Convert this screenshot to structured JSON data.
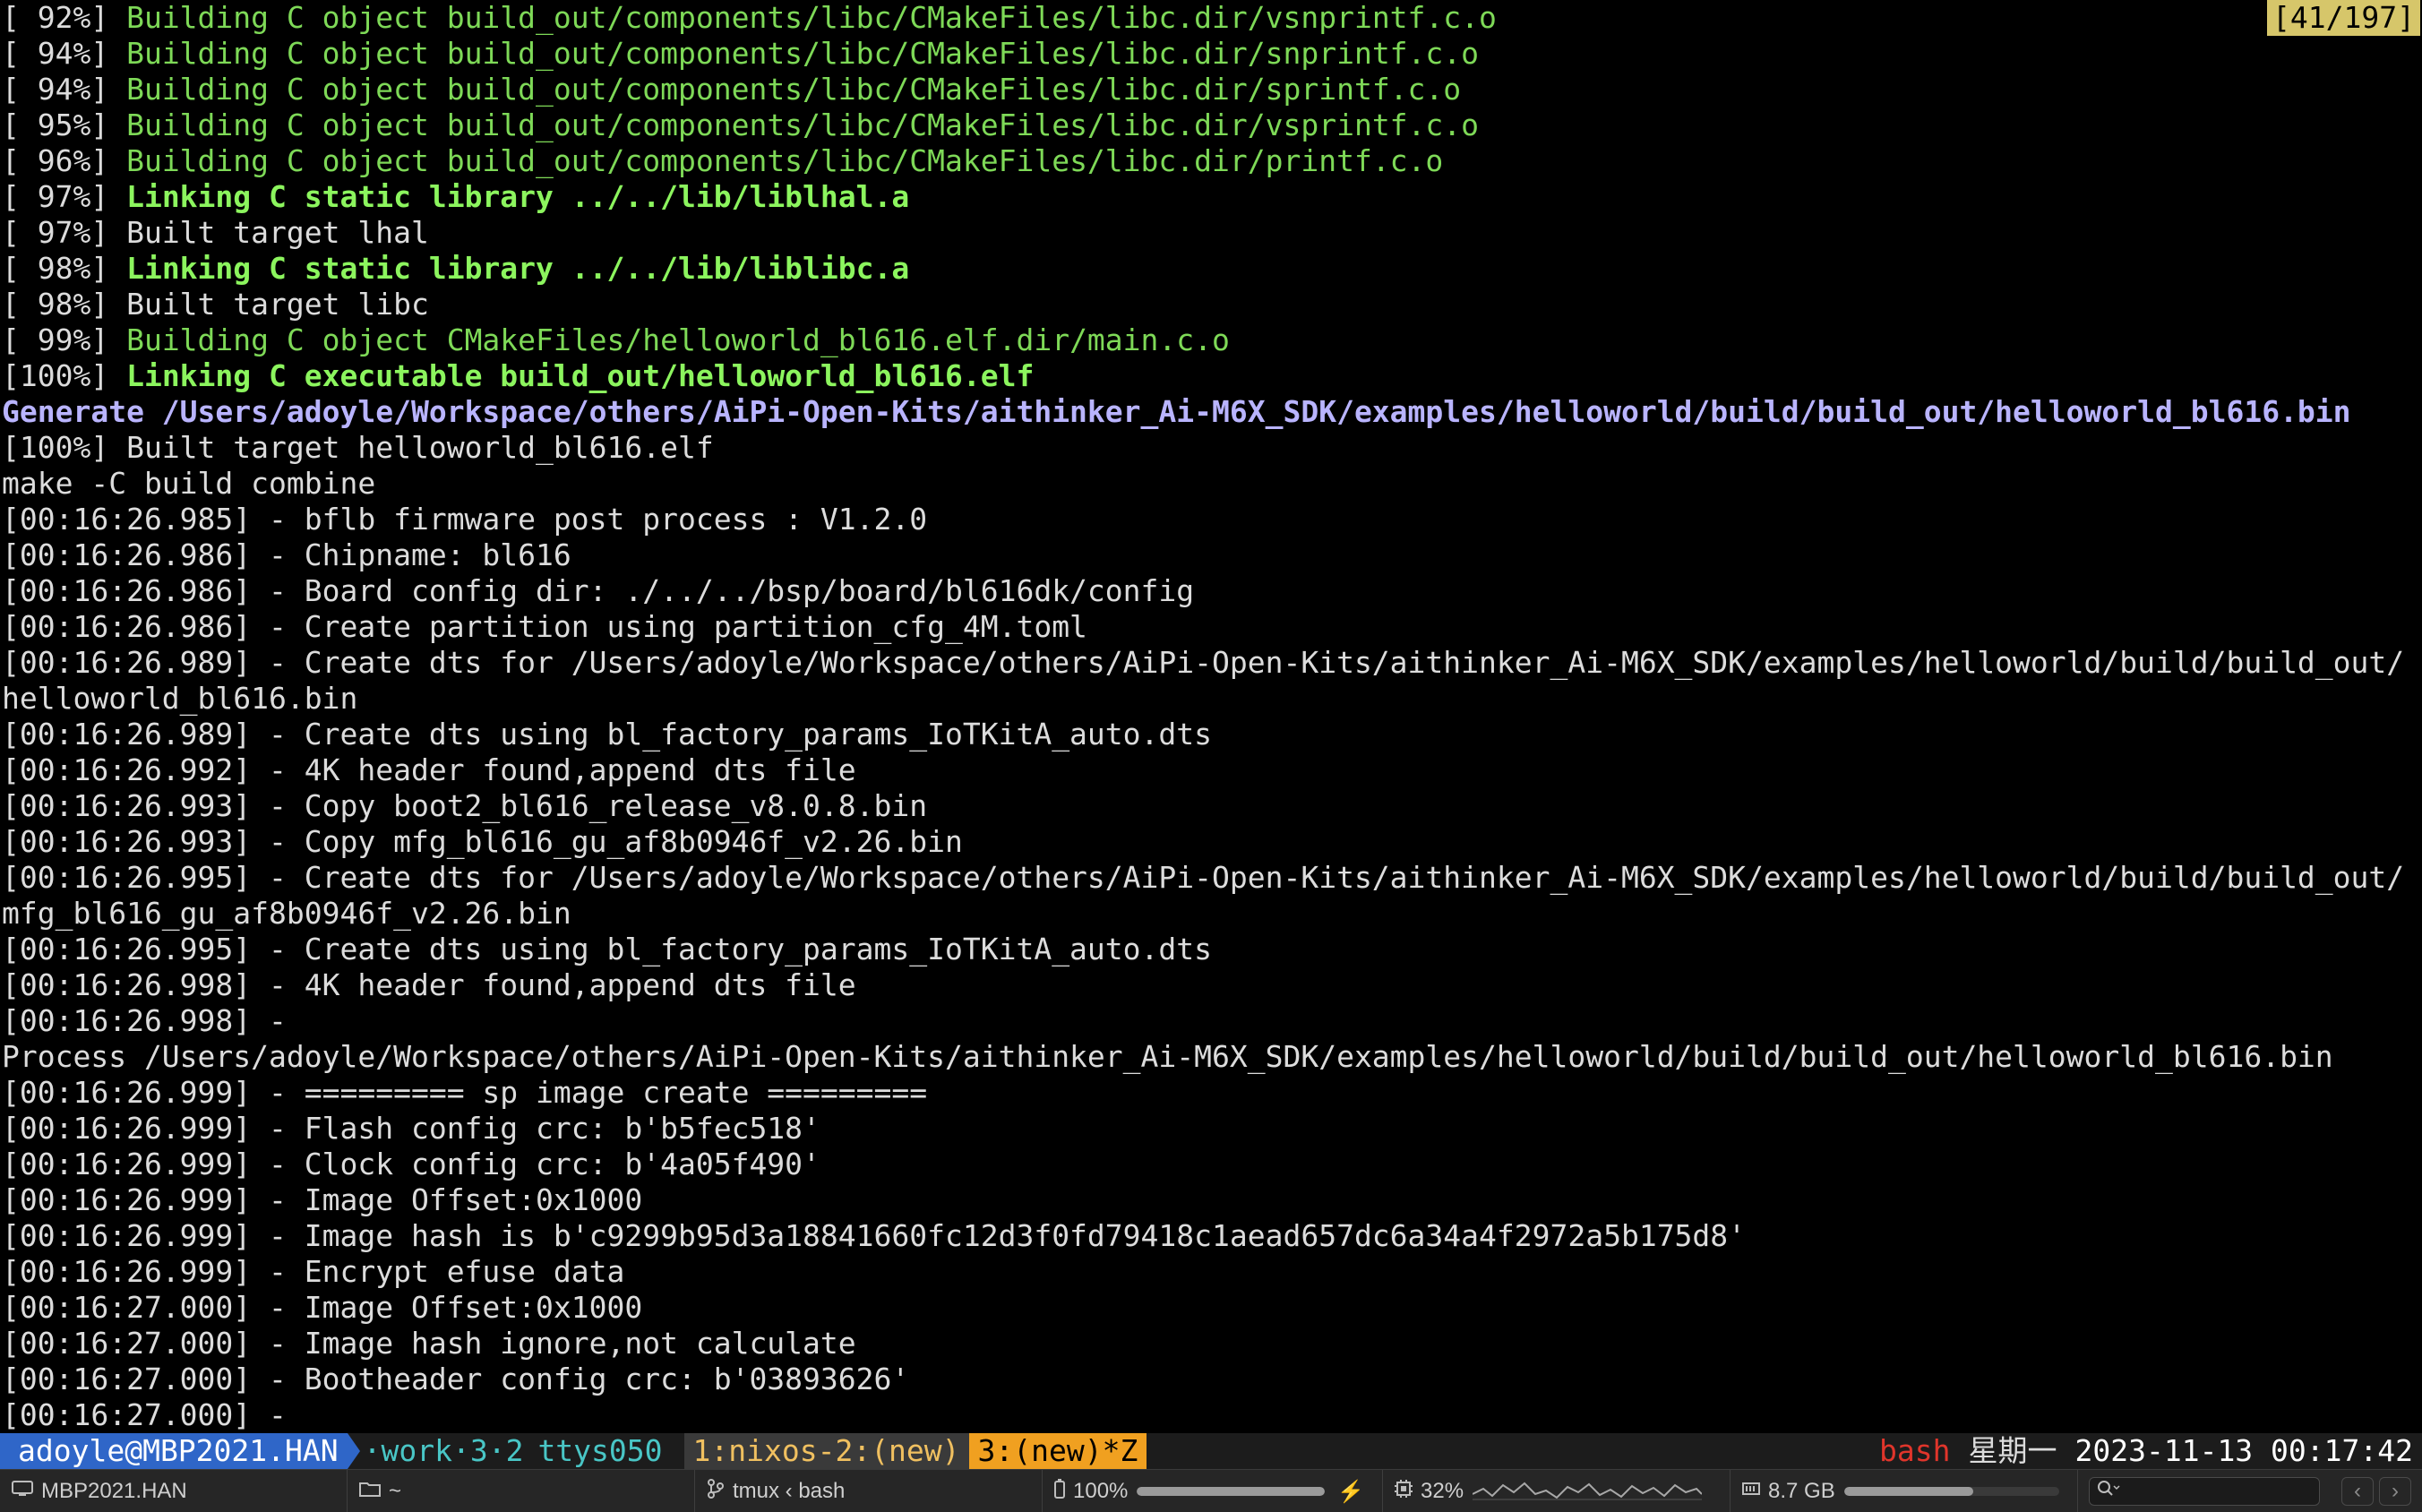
{
  "terminal": {
    "page_counter": "[41/197]",
    "lines": [
      {
        "prefix": "[ 92%] ",
        "text": "Building C object build_out/components/libc/CMakeFiles/libc.dir/vsnprintf.c.o",
        "style": "c-green"
      },
      {
        "prefix": "[ 94%] ",
        "text": "Building C object build_out/components/libc/CMakeFiles/libc.dir/snprintf.c.o",
        "style": "c-green"
      },
      {
        "prefix": "[ 94%] ",
        "text": "Building C object build_out/components/libc/CMakeFiles/libc.dir/sprintf.c.o",
        "style": "c-green"
      },
      {
        "prefix": "[ 95%] ",
        "text": "Building C object build_out/components/libc/CMakeFiles/libc.dir/vsprintf.c.o",
        "style": "c-green"
      },
      {
        "prefix": "[ 96%] ",
        "text": "Building C object build_out/components/libc/CMakeFiles/libc.dir/printf.c.o",
        "style": "c-green"
      },
      {
        "prefix": "[ 97%] ",
        "text": "Linking C static library ../../lib/liblhal.a",
        "style": "c-bgreen"
      },
      {
        "prefix": "[ 97%] ",
        "text": "Built target lhal",
        "style": "c-default"
      },
      {
        "prefix": "[ 98%] ",
        "text": "Linking C static library ../../lib/liblibc.a",
        "style": "c-bgreen"
      },
      {
        "prefix": "[ 98%] ",
        "text": "Built target libc",
        "style": "c-default"
      },
      {
        "prefix": "[ 99%] ",
        "text": "Building C object CMakeFiles/helloworld_bl616.elf.dir/main.c.o",
        "style": "c-green"
      },
      {
        "prefix": "[100%] ",
        "text": "Linking C executable build_out/helloworld_bl616.elf",
        "style": "c-bgreen"
      },
      {
        "prefix": "",
        "text": "Generate /Users/adoyle/Workspace/others/AiPi-Open-Kits/aithinker_Ai-M6X_SDK/examples/helloworld/build/build_out/helloworld_bl616.bin",
        "style": "c-purple"
      },
      {
        "prefix": "[100%] ",
        "text": "Built target helloworld_bl616.elf",
        "style": "c-default"
      },
      {
        "prefix": "",
        "text": "make -C build combine",
        "style": "c-default"
      },
      {
        "prefix": "",
        "text": "[00:16:26.985] - bflb firmware post process : V1.2.0",
        "style": "c-default"
      },
      {
        "prefix": "",
        "text": "[00:16:26.986] - Chipname: bl616",
        "style": "c-default"
      },
      {
        "prefix": "",
        "text": "[00:16:26.986] - Board config dir: ./../../bsp/board/bl616dk/config",
        "style": "c-default"
      },
      {
        "prefix": "",
        "text": "[00:16:26.986] - Create partition using partition_cfg_4M.toml",
        "style": "c-default"
      },
      {
        "prefix": "",
        "text": "[00:16:26.989] - Create dts for /Users/adoyle/Workspace/others/AiPi-Open-Kits/aithinker_Ai-M6X_SDK/examples/helloworld/build/build_out/",
        "style": "c-default"
      },
      {
        "prefix": "",
        "text": "helloworld_bl616.bin",
        "style": "c-default"
      },
      {
        "prefix": "",
        "text": "[00:16:26.989] - Create dts using bl_factory_params_IoTKitA_auto.dts",
        "style": "c-default"
      },
      {
        "prefix": "",
        "text": "[00:16:26.992] - 4K header found,append dts file",
        "style": "c-default"
      },
      {
        "prefix": "",
        "text": "[00:16:26.993] - Copy boot2_bl616_release_v8.0.8.bin",
        "style": "c-default"
      },
      {
        "prefix": "",
        "text": "[00:16:26.993] - Copy mfg_bl616_gu_af8b0946f_v2.26.bin",
        "style": "c-default"
      },
      {
        "prefix": "",
        "text": "[00:16:26.995] - Create dts for /Users/adoyle/Workspace/others/AiPi-Open-Kits/aithinker_Ai-M6X_SDK/examples/helloworld/build/build_out/",
        "style": "c-default"
      },
      {
        "prefix": "",
        "text": "mfg_bl616_gu_af8b0946f_v2.26.bin",
        "style": "c-default"
      },
      {
        "prefix": "",
        "text": "[00:16:26.995] - Create dts using bl_factory_params_IoTKitA_auto.dts",
        "style": "c-default"
      },
      {
        "prefix": "",
        "text": "[00:16:26.998] - 4K header found,append dts file",
        "style": "c-default"
      },
      {
        "prefix": "",
        "text": "[00:16:26.998] -",
        "style": "c-default"
      },
      {
        "prefix": "",
        "text": "Process /Users/adoyle/Workspace/others/AiPi-Open-Kits/aithinker_Ai-M6X_SDK/examples/helloworld/build/build_out/helloworld_bl616.bin",
        "style": "c-default"
      },
      {
        "prefix": "",
        "text": "[00:16:26.999] - ========= sp image create =========",
        "style": "c-default"
      },
      {
        "prefix": "",
        "text": "[00:16:26.999] - Flash config crc: b'b5fec518'",
        "style": "c-default"
      },
      {
        "prefix": "",
        "text": "[00:16:26.999] - Clock config crc: b'4a05f490'",
        "style": "c-default"
      },
      {
        "prefix": "",
        "text": "[00:16:26.999] - Image Offset:0x1000",
        "style": "c-default"
      },
      {
        "prefix": "",
        "text": "[00:16:26.999] - Image hash is b'c9299b95d3a18841660fc12d3f0fd79418c1aead657dc6a34a4f2972a5b175d8'",
        "style": "c-default"
      },
      {
        "prefix": "",
        "text": "[00:16:26.999] - Encrypt efuse data",
        "style": "c-default"
      },
      {
        "prefix": "",
        "text": "[00:16:27.000] - Image Offset:0x1000",
        "style": "c-default"
      },
      {
        "prefix": "",
        "text": "[00:16:27.000] - Image hash ignore,not calculate",
        "style": "c-default"
      },
      {
        "prefix": "",
        "text": "[00:16:27.000] - Bootheader config crc: b'03893626'",
        "style": "c-default"
      },
      {
        "prefix": "",
        "text": "[00:16:27.000] -",
        "style": "c-default"
      }
    ]
  },
  "tmux": {
    "session": "adoyle@MBP2021.HAN",
    "work": "·work·3·2",
    "tty": "ttys050",
    "window1": "1:nixos-2:(new)",
    "window2": "3:(new)*Z",
    "shell": "bash",
    "weekday": "星期一",
    "datetime": "2023-11-13 00:17:42"
  },
  "menubar": {
    "host": "MBP2021.HAN",
    "host_icon": "monitor-icon",
    "folder": "~",
    "folder_icon": "folder-icon",
    "process": "tmux ‹ bash",
    "process_icon": "branch-icon",
    "battery": "100%",
    "battery_level": 1.0,
    "cpu": "32%",
    "memory": "8.7 GB",
    "memory_level": 0.6
  },
  "colors": {
    "green": "#7ed957",
    "bright_green": "#8cf55e",
    "purple": "#b9b4ff",
    "session_blue": "#2f66c8",
    "window_active": "#f0a020",
    "shell_red": "#e0352b"
  }
}
